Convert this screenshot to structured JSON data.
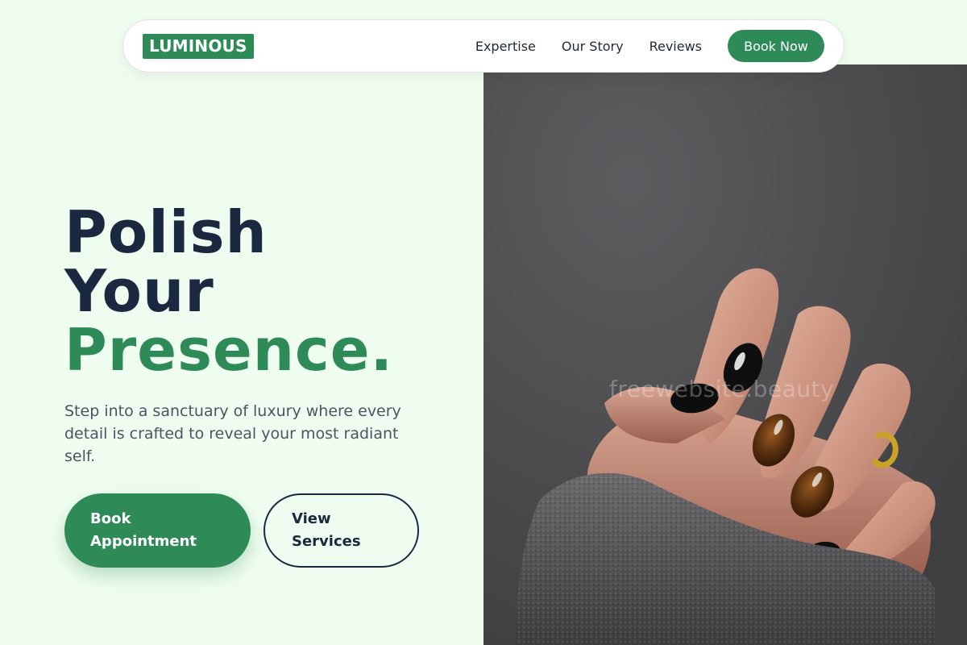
{
  "nav": {
    "logo": "LUMINOUS",
    "links": [
      "Expertise",
      "Our Story",
      "Reviews"
    ],
    "cta": "Book Now"
  },
  "hero": {
    "title_line1": "Polish",
    "title_line2": "Your",
    "title_line3": "Presence.",
    "subtitle": "Step into a sanctuary of luxury where every detail is crafted to reveal your most radiant self.",
    "primary_button": "Book Appointment",
    "secondary_button": "View Services"
  },
  "image": {
    "watermark": "freewebsite.beauty"
  },
  "colors": {
    "background": "#effdf0",
    "brand_green": "#2e8b57",
    "heading_navy": "#1b2940",
    "body_text": "#4a5563",
    "photo_backdrop": "#505052"
  }
}
